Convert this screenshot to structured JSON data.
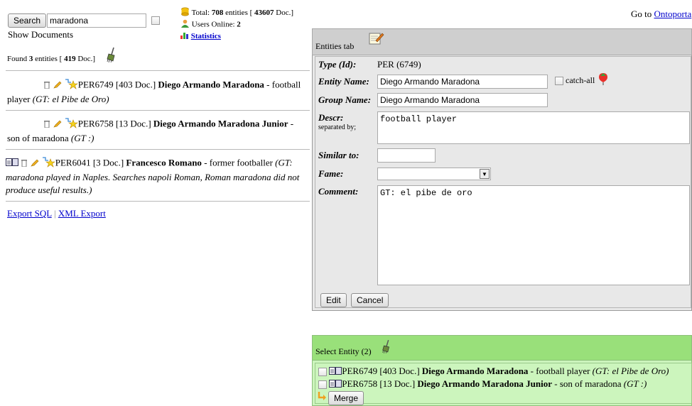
{
  "search": {
    "button_label": "Search",
    "query_value": "maradona",
    "show_documents": "Show Documents"
  },
  "stats": {
    "total_prefix": "Total:",
    "total_entities": "708",
    "entities_word": "entities [",
    "total_docs": "43607",
    "docs_suffix": "Doc.]",
    "users_prefix": "Users Online:",
    "users_online": "2",
    "statistics_link": "Statistics"
  },
  "goto": {
    "prefix": "Go to",
    "link": "Ontoporta"
  },
  "results": {
    "found_prefix": "Found",
    "found_count": "3",
    "found_mid": "entities [",
    "found_docs": "419",
    "found_suffix": "Doc.]",
    "items": [
      {
        "id": "PER6749",
        "docs": "[403 Doc.]",
        "name": "Diego Armando Maradona",
        "desc": "- football player",
        "note": "(GT: el Pibe de Oro)"
      },
      {
        "id": "PER6758",
        "docs": "[13 Doc.]",
        "name": "Diego Armando Maradona Junior",
        "desc": "- son of maradona",
        "note": "(GT :)"
      },
      {
        "id": "PER6041",
        "docs": "[3 Doc.]",
        "name": "Francesco Romano",
        "desc": "- former footballer",
        "note": "(GT: maradona played in Naples. Searches napoli Roman, Roman maradona did not produce useful results.)"
      }
    ]
  },
  "export": {
    "sql": "Export SQL",
    "separator": "|",
    "xml": "XML Export"
  },
  "entities_tab": {
    "title": "Entities tab",
    "type_label": "Type (Id):",
    "type_value": "PER (6749)",
    "name_label": "Entity Name:",
    "name_value": "Diego Armando Maradona",
    "catch_all": "catch-all",
    "group_label": "Group Name:",
    "group_value": "Diego Armando Maradona",
    "descr_label": "Descr:",
    "descr_sub": "separated by;",
    "descr_value": "football player",
    "similar_label": "Similar to:",
    "similar_value": "",
    "fame_label": "Fame:",
    "fame_value": "",
    "comment_label": "Comment:",
    "comment_value": "GT: el pibe de oro",
    "edit_button": "Edit",
    "cancel_button": "Cancel"
  },
  "select_entity": {
    "title": "Select Entity (2)",
    "items": [
      {
        "id": "PER6749",
        "docs": "[403 Doc.]",
        "name": "Diego Armando Maradona",
        "desc": "- football player",
        "note": "(GT: el Pibe de Oro)"
      },
      {
        "id": "PER6758",
        "docs": "[13 Doc.]",
        "name": "Diego Armando Maradona Junior",
        "desc": "- son of maradona",
        "note": "(GT :)"
      }
    ],
    "merge_button": "Merge"
  },
  "colors": {
    "panel_gray": "#e8e8e8",
    "panel_head": "#cfcfcf",
    "green_head": "#99e07a",
    "green_body": "#ccf5bd",
    "link": "#0000cc"
  }
}
